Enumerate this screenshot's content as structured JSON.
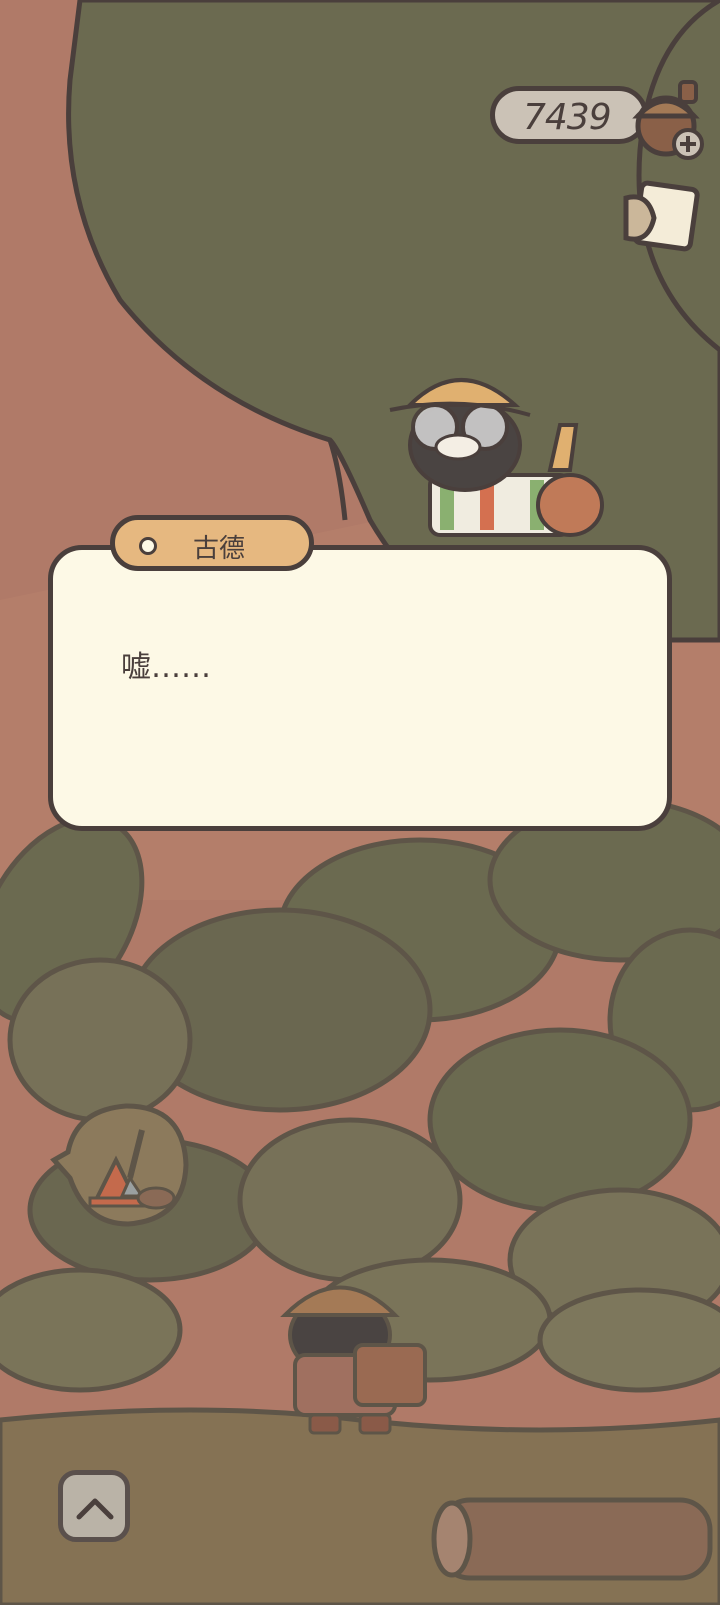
{
  "currency": {
    "value": "7439",
    "icon": "acorn-plus-icon"
  },
  "map_button": {
    "icon": "map-icon"
  },
  "dialog": {
    "speaker": "古德",
    "text": "嘘……"
  },
  "dig_bubble": {
    "icon": "shovel-cone-icon"
  },
  "expand_button": {
    "icon": "chevron-up-icon"
  },
  "colors": {
    "background": "#b07a68",
    "foliage": "#6b6a50",
    "outline": "#4a3f3c",
    "dialog_bg": "#fdf9e6",
    "name_tag": "#e6b880",
    "ground": "#857254"
  }
}
